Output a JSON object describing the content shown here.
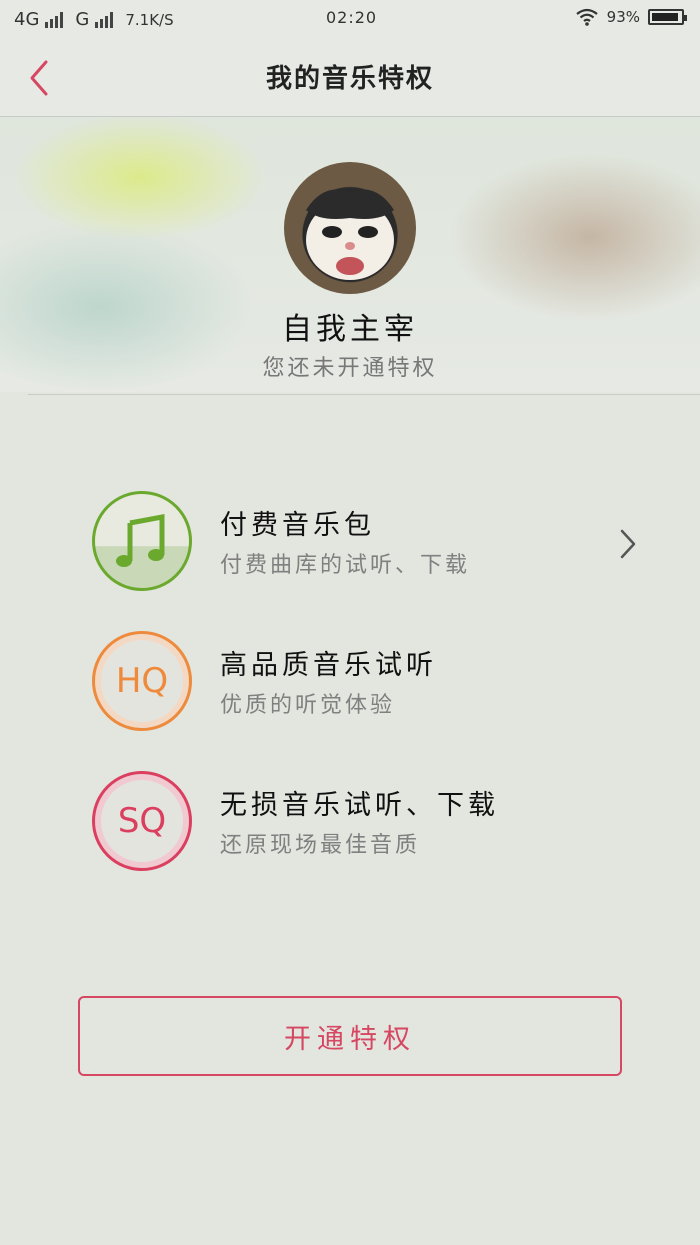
{
  "status_bar": {
    "network_1": "4G",
    "network_2": "G",
    "speed": "7.1K/S",
    "time": "02:20",
    "battery": "93%"
  },
  "nav": {
    "title": "我的音乐特权"
  },
  "profile": {
    "username": "自我主宰",
    "notice": "您还未开通特权"
  },
  "features": [
    {
      "title": "付费音乐包",
      "desc": "付费曲库的试听、下载",
      "icon": "music-note-icon",
      "color": "#6aa92d"
    },
    {
      "title": "高品质音乐试听",
      "desc": "优质的听觉体验",
      "icon_text": "HQ",
      "color": "#ee8a3c"
    },
    {
      "title": "无损音乐试听、下载",
      "desc": "还原现场最佳音质",
      "icon_text": "SQ",
      "color": "#db3f5f"
    }
  ],
  "action": {
    "label": "开通特权"
  }
}
